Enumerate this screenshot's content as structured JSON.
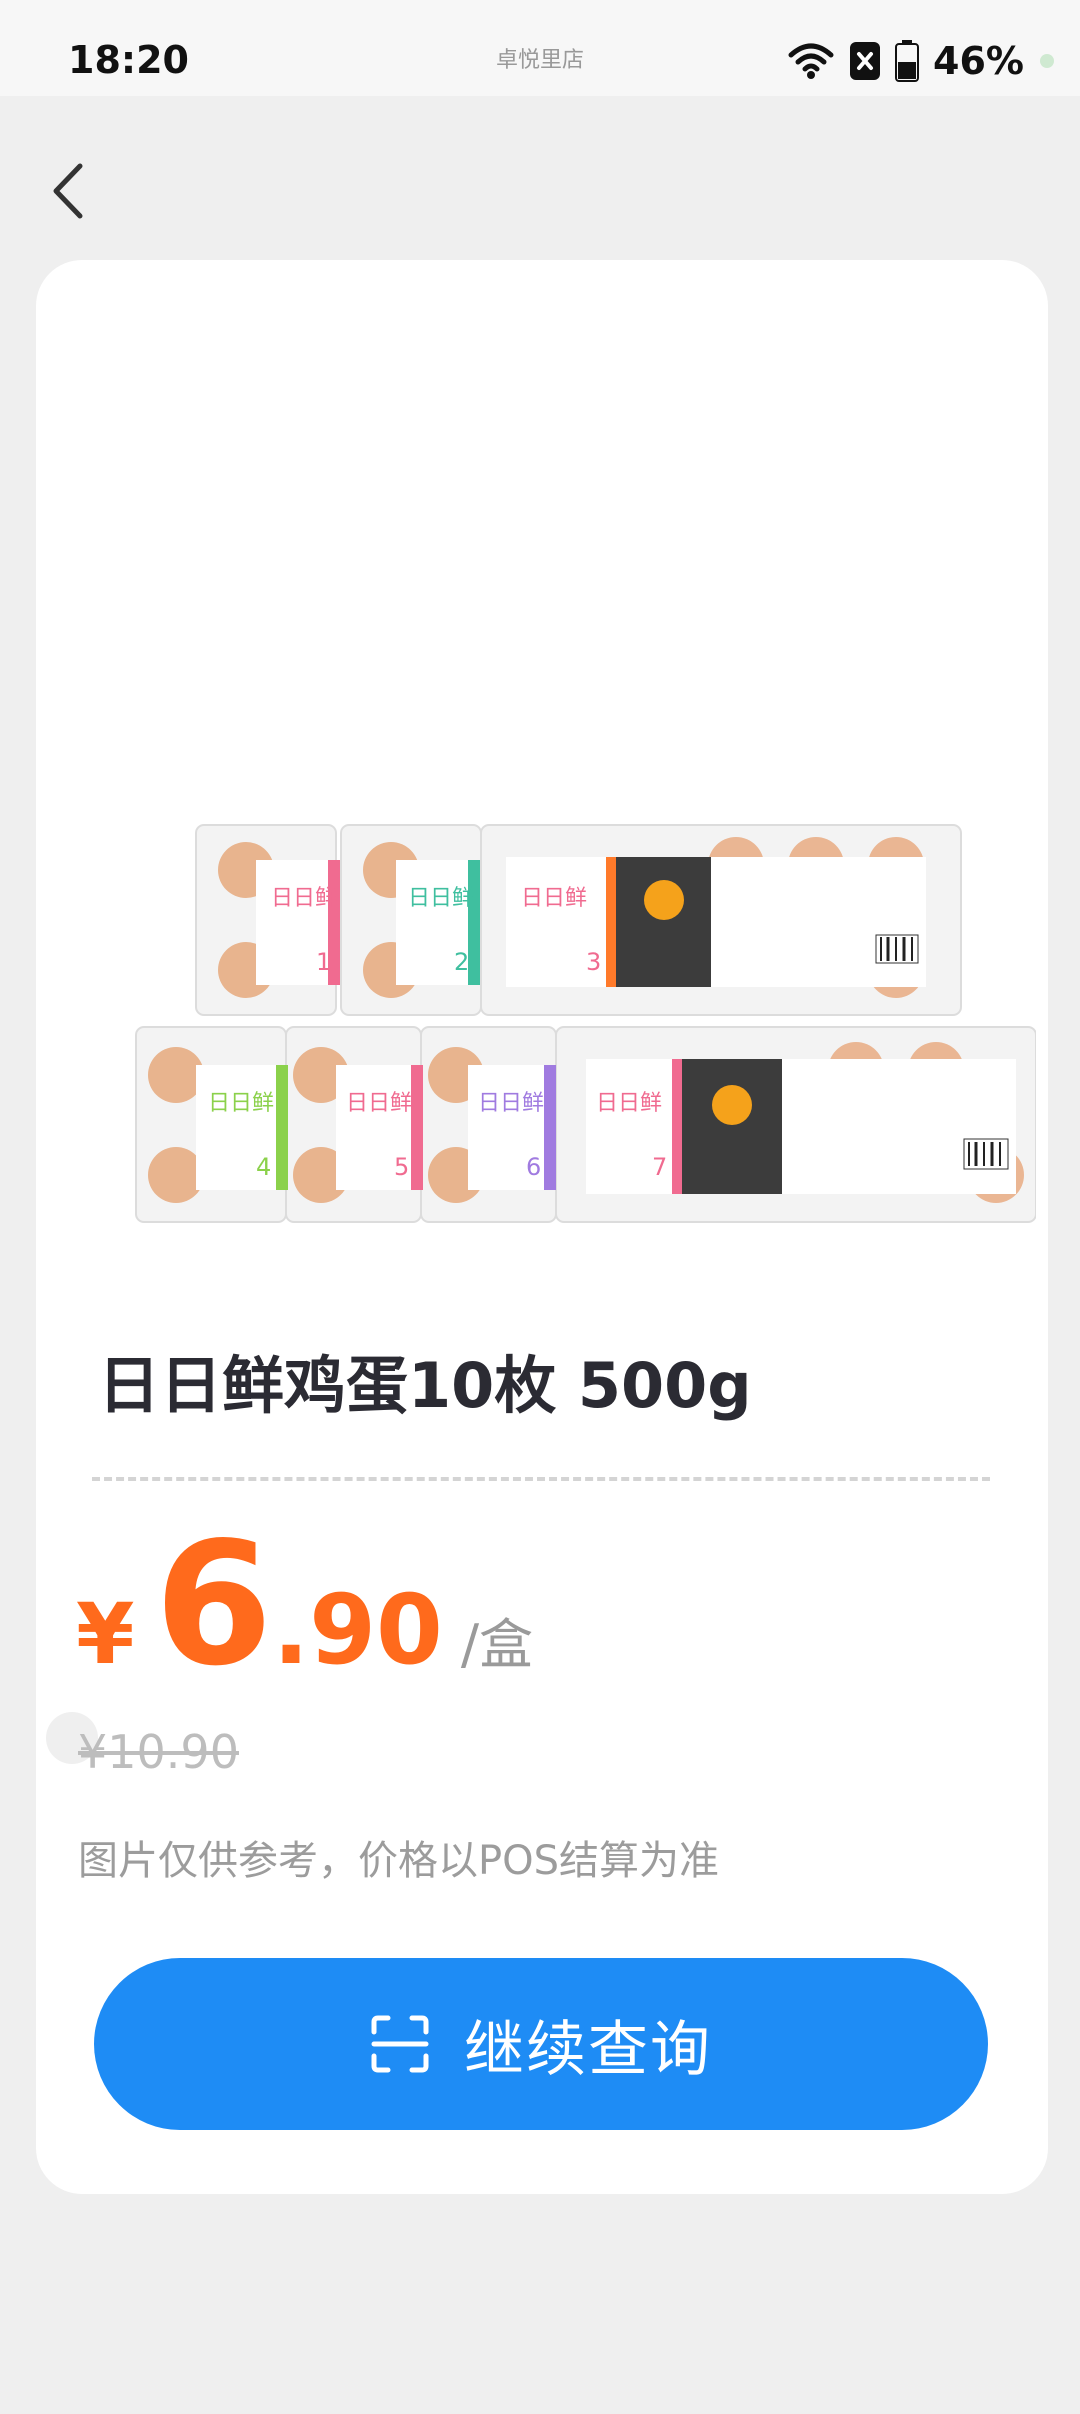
{
  "status_bar": {
    "time": "18:20",
    "carrier": "卓悦里店",
    "battery": "46%"
  },
  "nav": {
    "back_icon": "chevron-left-icon"
  },
  "product": {
    "image_alt": "日日鲜鸡蛋 egg cartons 1-7",
    "carton_labels": [
      "日日鲜",
      "1",
      "2",
      "3",
      "4",
      "5",
      "6",
      "7"
    ],
    "name": "日日鲜鸡蛋10枚 500g",
    "price_currency": "¥",
    "price_integer": "6",
    "price_decimal": ".90",
    "price_unit": "/盒",
    "original_price": "¥10.90",
    "note": "图片仅供参考，价格以POS结算为准"
  },
  "action": {
    "scan_icon": "scan-icon",
    "label": "继续查询"
  },
  "colors": {
    "accent_blue": "#1e8cf5",
    "price_orange": "#ff6a1c",
    "background": "#efefef"
  }
}
